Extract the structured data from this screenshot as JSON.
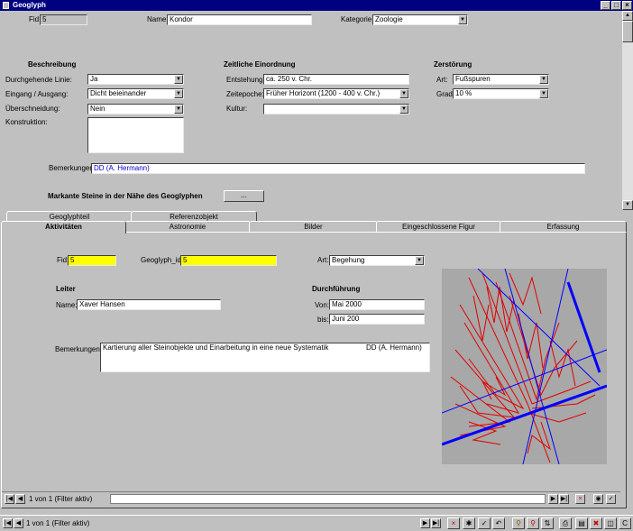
{
  "window": {
    "title": "Geoglyph",
    "min": "_",
    "max": "□",
    "close": "×"
  },
  "header": {
    "fid_label": "Fid:",
    "fid_value": "5",
    "name_label": "Name:",
    "name_value": "Kondor",
    "kategorie_label": "Kategorie:",
    "kategorie_value": "Zoologie"
  },
  "beschreibung": {
    "title": "Beschreibung",
    "linie_label": "Durchgehende Linie:",
    "linie_value": "Ja",
    "eingang_label": "Eingang / Ausgang:",
    "eingang_value": "Dicht beieinander",
    "ueberschneidung_label": "Überschneidung:",
    "ueberschneidung_value": "Nein",
    "konstruktion_label": "Konstruktion:",
    "konstruktion_value": ""
  },
  "zeitliche": {
    "title": "Zeitliche Einordnung",
    "entstehung_label": "Entstehung:",
    "entstehung_value": "ca. 250 v. Chr.",
    "zeitepoche_label": "Zeitepoche:",
    "zeitepoche_value": "Früher Horizont (1200 - 400 v. Chr.)",
    "kultur_label": "Kultur:",
    "kultur_value": ""
  },
  "zerstoerung": {
    "title": "Zerstörung",
    "art_label": "Art:",
    "art_value": "Fußspuren",
    "grad_label": "Grad:",
    "grad_value": "10 %"
  },
  "bemerkungen_top": {
    "label": "Bemerkungen:",
    "value": "DD (A. Hermann)"
  },
  "markante": {
    "label": "Markante Steine in der Nähe des Geoglyphen",
    "button": "..."
  },
  "tabs_row1": [
    "Geoglyphteil",
    "Referenzobjekt"
  ],
  "tabs_row2": [
    "Aktivitäten",
    "Astronomie",
    "Bilder",
    "Eingeschlossene Figur",
    "Erfassung"
  ],
  "sub": {
    "fid_label": "Fid:",
    "fid_value": "5",
    "geoglyph_id_label": "Geoglyph_id:",
    "geoglyph_id_value": "5",
    "art_label": "Art:",
    "art_value": "Begehung",
    "leiter_title": "Leiter",
    "name_label": "Name:",
    "name_value": "Xaver Hansen",
    "durchfuehrung_title": "Durchführung",
    "von_label": "Von:",
    "von_value": "Mai 2000",
    "bis_label": "bis:",
    "bis_value": "Juni 200",
    "bemerkungen_label": "Bemerkungen:",
    "bemerkungen_value": "Kartierung aller Steinobjekte und Einarbeitung in eine neue Systematik",
    "bemerkungen_author": "DD (A. Hermann)"
  },
  "subnav": {
    "record_text": "1 von 1 (Filter aktiv)"
  },
  "mainnav": {
    "record_text": "1 von 1 (Filter aktiv)"
  },
  "icons": {
    "first": "first-record-icon",
    "prev": "previous-record-icon",
    "next": "next-record-icon",
    "last": "last-record-icon",
    "delete": "delete-record-icon",
    "new": "new-record-icon",
    "save": "save-icon",
    "undo": "undo-icon",
    "filter": "filter-icon",
    "print": "print-icon",
    "close": "close-form-icon"
  },
  "colors": {
    "titlebar": "#000080",
    "highlight": "#ffff00",
    "glyph_line": "#e00000",
    "survey_line": "#0000ff"
  }
}
